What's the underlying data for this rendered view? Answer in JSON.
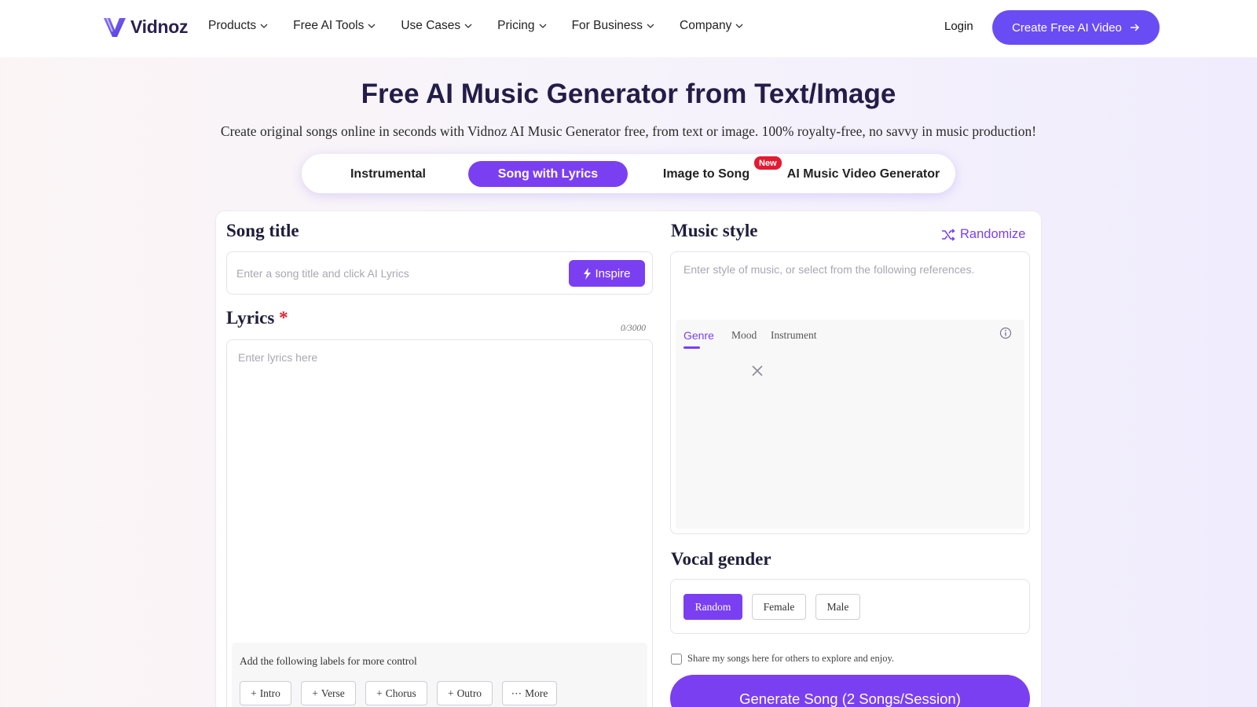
{
  "nav": {
    "logo_text": "Vidnoz",
    "menu": [
      "Products",
      "Free AI Tools",
      "Use Cases",
      "Pricing",
      "For Business",
      "Company"
    ],
    "login": "Login",
    "cta": "Create Free AI Video"
  },
  "hero": {
    "title": "Free AI Music Generator from Text/Image",
    "subtitle": "Create original songs online in seconds with Vidnoz AI Music Generator free, from text or image. 100% royalty-free, no savvy in music production!"
  },
  "tabs": {
    "items": [
      "Instrumental",
      "Song with Lyrics",
      "Image to Song",
      "AI Music Video Generator"
    ],
    "active": "Song with Lyrics",
    "new_badge": "New"
  },
  "song_title": {
    "heading": "Song title",
    "placeholder": "Enter a song title and click AI Lyrics",
    "inspire": "Inspire"
  },
  "lyrics": {
    "heading": "Lyrics",
    "required_mark": "*",
    "counter": "0/3000",
    "placeholder": "Enter lyrics here",
    "labels_hint": "Add the following labels for more control",
    "labels": [
      "Intro",
      "Verse",
      "Chorus",
      "Outro"
    ],
    "more": "More"
  },
  "music_style": {
    "heading": "Music style",
    "randomize": "Randomize",
    "placeholder": "Enter style of music, or select from the following references.",
    "tabs": [
      "Genre",
      "Mood",
      "Instrument"
    ]
  },
  "vocal_gender": {
    "heading": "Vocal gender",
    "options": [
      "Random",
      "Female",
      "Male"
    ],
    "selected": "Random"
  },
  "share_text": "Share my songs here for others to explore and enjoy.",
  "generate": "Generate Song (2 Songs/Session)",
  "colors": {
    "accent": "#7b3ff2",
    "cta": "#6a4cf5",
    "badge": "#e21b32"
  }
}
